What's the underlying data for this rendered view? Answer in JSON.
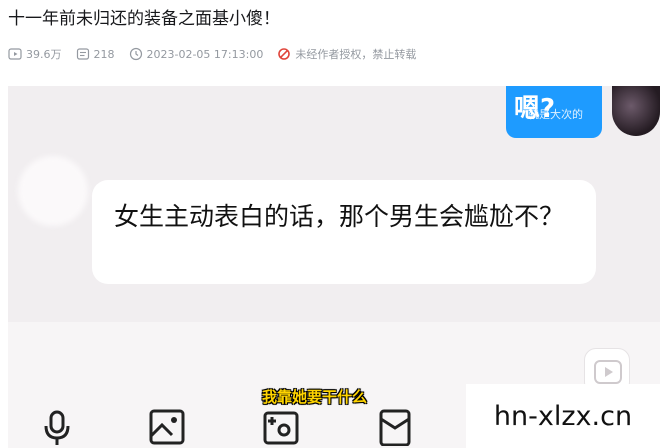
{
  "post": {
    "title": "十一年前未归还的装备之面基小傻！",
    "meta": {
      "views": "39.6万",
      "comments": "218",
      "datetime": "2023-02-05 17:13:00",
      "copyright": "未经作者授权，禁止转载"
    }
  },
  "video": {
    "top_bubble_big": "嗯?",
    "top_bubble_small": "就是大次的",
    "avatar_label": "",
    "chat_message": "女生主动表白的话，那个男生会尴尬不？",
    "subtitle": "我靠她要干什么",
    "toolbar": [
      {
        "icon": "microphone-icon"
      },
      {
        "icon": "image-icon"
      },
      {
        "icon": "camera-plus-icon"
      },
      {
        "icon": "red-packet-icon"
      },
      {
        "icon": "emoji-icon"
      },
      {
        "icon": "plus-icon"
      }
    ]
  },
  "watermark": {
    "text": "hn-xlzx.cn"
  },
  "colors": {
    "title": "#18191c",
    "meta": "#9499a0",
    "bubble_blue": "#1e9bff",
    "video_bg": "#f1eef0",
    "subtitle": "#ffd400"
  }
}
